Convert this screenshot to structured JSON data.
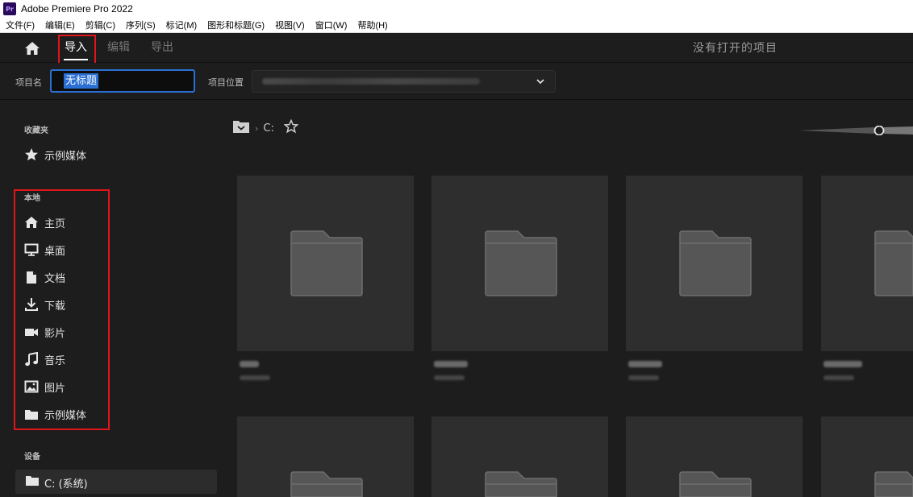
{
  "window": {
    "title": "Adobe Premiere Pro 2022",
    "app_icon_text": "Pr"
  },
  "menu": [
    "文件(F)",
    "编辑(E)",
    "剪辑(C)",
    "序列(S)",
    "标记(M)",
    "图形和标题(G)",
    "视图(V)",
    "窗口(W)",
    "帮助(H)"
  ],
  "topnav": {
    "tabs": [
      {
        "label": "导入",
        "active": true
      },
      {
        "label": "编辑",
        "active": false
      },
      {
        "label": "导出",
        "active": false
      }
    ],
    "status": "没有打开的项目"
  },
  "project": {
    "name_label": "项目名",
    "name_value": "无标题",
    "location_label": "项目位置"
  },
  "sidebar": {
    "favorites_title": "收藏夹",
    "favorites": [
      {
        "label": "示例媒体",
        "icon": "star-icon"
      }
    ],
    "local_title": "本地",
    "local": [
      {
        "label": "主页",
        "icon": "home-icon"
      },
      {
        "label": "桌面",
        "icon": "desktop-icon"
      },
      {
        "label": "文档",
        "icon": "document-icon"
      },
      {
        "label": "下载",
        "icon": "download-icon"
      },
      {
        "label": "影片",
        "icon": "video-icon"
      },
      {
        "label": "音乐",
        "icon": "music-icon"
      },
      {
        "label": "图片",
        "icon": "image-icon"
      },
      {
        "label": "示例媒体",
        "icon": "folder-icon"
      }
    ],
    "devices_title": "设备",
    "devices": [
      {
        "label": "C: (系统)",
        "icon": "folder-icon"
      }
    ]
  },
  "browser": {
    "breadcrumb_drive": "C:"
  },
  "colors": {
    "background": "#1d1d1d",
    "tile": "#2e2e2e",
    "accent_blue": "#2a6fd3",
    "highlight_red": "#e0151b"
  }
}
